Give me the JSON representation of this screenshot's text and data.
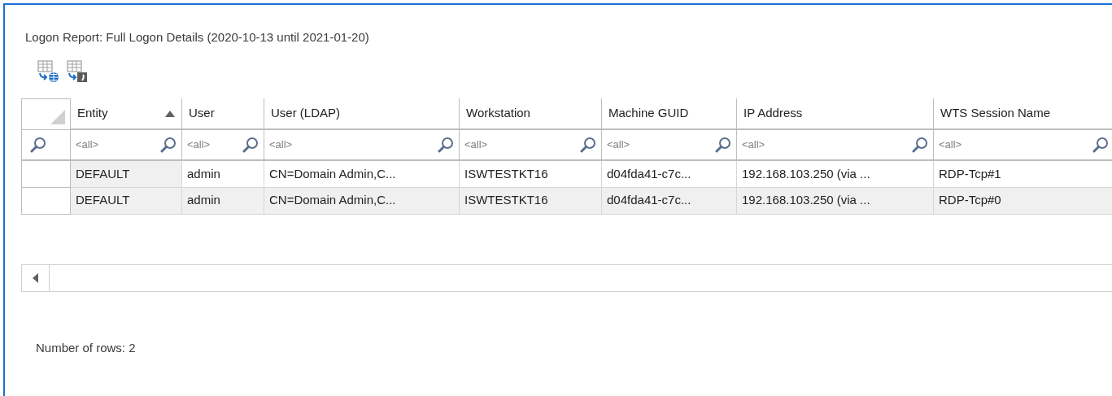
{
  "report": {
    "title": "Logon Report: Full Logon Details (2020-10-13 until 2021-01-20)"
  },
  "toolbar": [
    {
      "kind": "web"
    },
    {
      "kind": "export"
    }
  ],
  "table": {
    "columns": [
      {
        "label": "Entity",
        "sorted": true,
        "filter_placeholder": "<all>"
      },
      {
        "label": "User",
        "sorted": false,
        "filter_placeholder": "<all>"
      },
      {
        "label": "User (LDAP)",
        "sorted": false,
        "filter_placeholder": "<all>"
      },
      {
        "label": "Workstation",
        "sorted": false,
        "filter_placeholder": "<all>"
      },
      {
        "label": "Machine GUID",
        "sorted": false,
        "filter_placeholder": "<all>"
      },
      {
        "label": "IP Address",
        "sorted": false,
        "filter_placeholder": "<all>"
      },
      {
        "label": "WTS Session Name",
        "sorted": false,
        "filter_placeholder": "<all>"
      }
    ],
    "rows": [
      {
        "selected": false,
        "cells": [
          "DEFAULT",
          "admin",
          "CN=Domain Admin,C...",
          "ISWTESTKT16",
          "d04fda41-c7c...",
          "192.168.103.250 (via ...",
          "RDP-Tcp#1"
        ]
      },
      {
        "selected": true,
        "cells": [
          "DEFAULT",
          "admin",
          "CN=Domain Admin,C...",
          "ISWTESTKT16",
          "d04fda41-c7c...",
          "192.168.103.250 (via ...",
          "RDP-Tcp#0"
        ]
      }
    ]
  },
  "status_bar": {
    "text": "Number of rows: 2"
  }
}
